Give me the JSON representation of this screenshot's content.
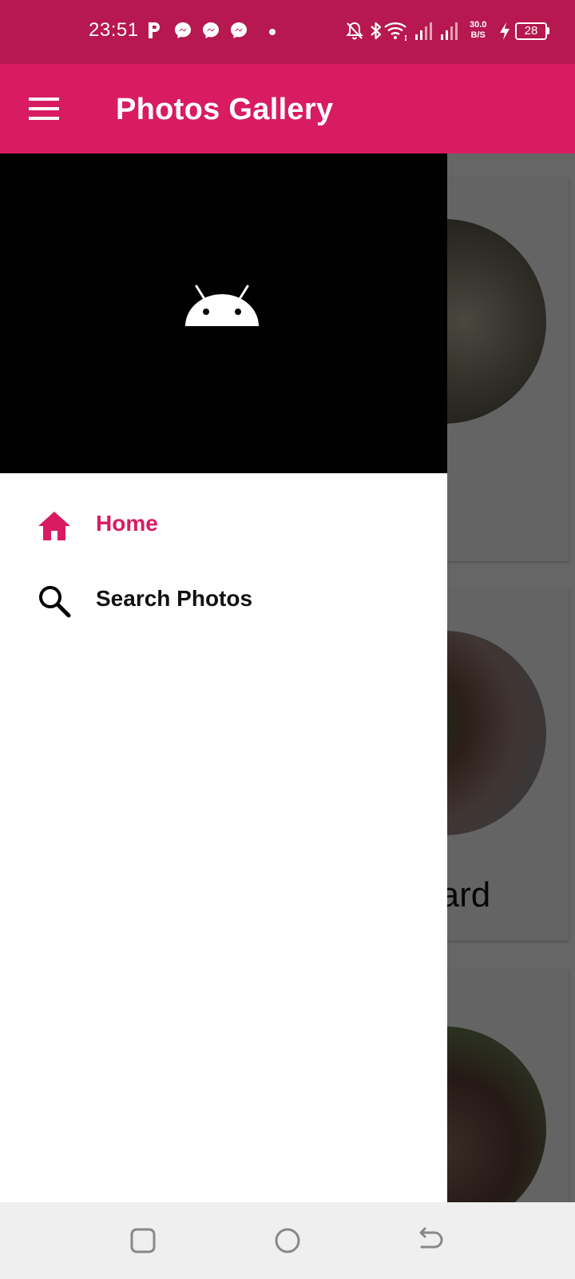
{
  "status_bar": {
    "time": "23:51",
    "net_speed_value": "30.0",
    "net_speed_unit": "B/S",
    "battery": "28",
    "icons": [
      "parking-icon",
      "messenger-icon",
      "messenger-icon",
      "messenger-icon",
      "dot-icon",
      "bell-muted-icon",
      "bluetooth-icon",
      "wifi-icon",
      "signal-icon",
      "signal-icon",
      "charging-icon"
    ]
  },
  "app_bar": {
    "title": "Photos Gallery",
    "menu_icon": "hamburger-menu-icon"
  },
  "drawer": {
    "header_icon": "android-icon",
    "items": [
      {
        "label": "Home",
        "icon": "home-icon",
        "selected": true
      },
      {
        "label": "Search Photos",
        "icon": "search-icon",
        "selected": false
      }
    ]
  },
  "content": {
    "cards": [
      {
        "caption": ""
      },
      {
        "caption": "mallard"
      },
      {
        "caption": ""
      }
    ]
  },
  "nav_bar": {
    "buttons": [
      "recents-button",
      "home-button",
      "back-button"
    ]
  },
  "colors": {
    "status_bar": "#b6184f",
    "app_bar": "#d91b62",
    "accent": "#d91b62"
  }
}
